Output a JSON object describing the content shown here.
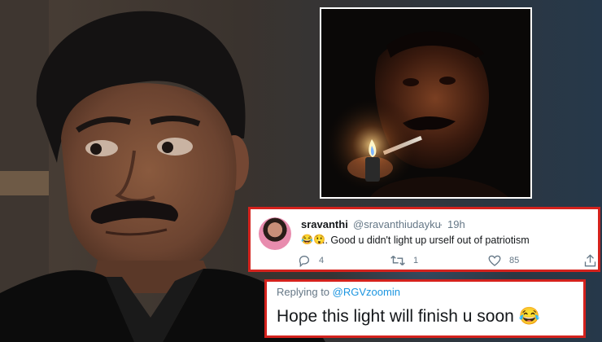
{
  "tweet": {
    "display_name": "sravanthi",
    "handle": "@sravanthiudayku",
    "separator": "·",
    "time": "19h",
    "emojis": "😂😲",
    "text": ".. Good u didn't light up urself out of patriotism",
    "reply_count": "4",
    "retweet_count": "1",
    "like_count": "85"
  },
  "reply": {
    "replying_prefix": "Replying to ",
    "replying_to": "@RGVzoomin",
    "text": "Hope this light will finish u soon 😂"
  },
  "colors": {
    "highlight_border": "#d4221d",
    "mention": "#1b95e0",
    "muted_text": "#657786"
  },
  "icons": [
    "reply-icon",
    "retweet-icon",
    "like-icon",
    "share-icon"
  ]
}
